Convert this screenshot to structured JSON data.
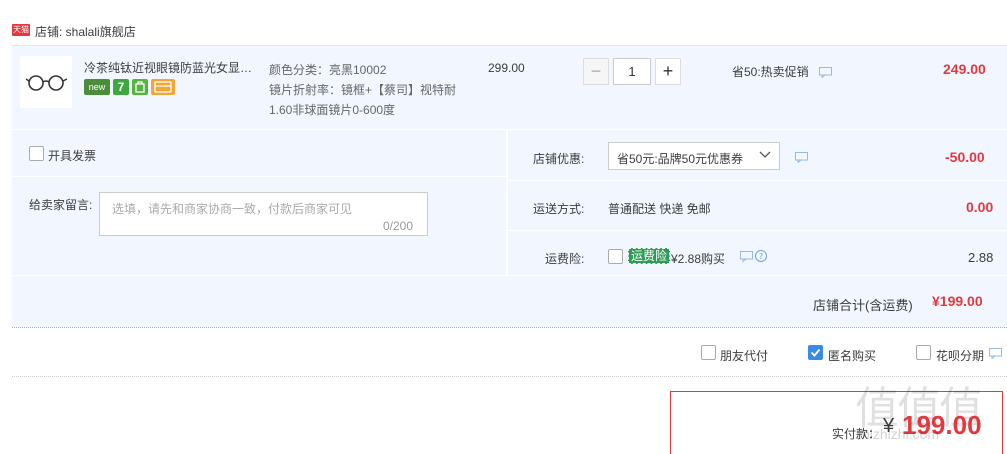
{
  "shop": {
    "badge": "天猫",
    "name": "店铺: shalali旗舰店"
  },
  "item": {
    "title": "冷茶纯钛近视眼镜防蓝光女显脸小",
    "badges": [
      "new",
      "7",
      "",
      ""
    ],
    "sku_line1": "颜色分类：亮黑10002",
    "sku_line2": "镜片折射率：镜框+【蔡司】视特耐1.60非球面镜片0-600度",
    "price": "299.00",
    "qty": "1",
    "qty_minus": "−",
    "qty_plus": "+",
    "promo": "省50:热卖促销",
    "total": "249.00"
  },
  "options": {
    "invoice_label": "开具发票",
    "message_label": "给卖家留言:",
    "message_placeholder": "选填，请先和商家协商一致，付款后商家可见",
    "message_count": "0/200",
    "store_discount_label": "店铺优惠:",
    "store_discount_value": "省50元:品牌50元优惠券",
    "store_discount_amount": "-50.00",
    "shipping_label": "运送方式:",
    "shipping_value": "普通配送 快递 免邮",
    "shipping_amount": "0.00",
    "insurance_label": "运费险:",
    "insurance_tag": "运费险",
    "insurance_price": "¥2.88购买",
    "insurance_amount": "2.88"
  },
  "subtotal": {
    "label": "店铺合计(含运费)",
    "amount": "¥199.00"
  },
  "extras": {
    "friend_pay": "朋友代付",
    "anonymous": "匿名购买",
    "huabei": "花呗分期"
  },
  "payment": {
    "label": "实付款：",
    "currency": "¥",
    "amount": "199.00"
  },
  "watermark": {
    "text": "值值值",
    "url": "zhizhizhi.com"
  },
  "colors": {
    "accent": "#e4393c",
    "panel_bg": "#f2f7ff",
    "checkbox_checked": "#3b8ae6"
  }
}
